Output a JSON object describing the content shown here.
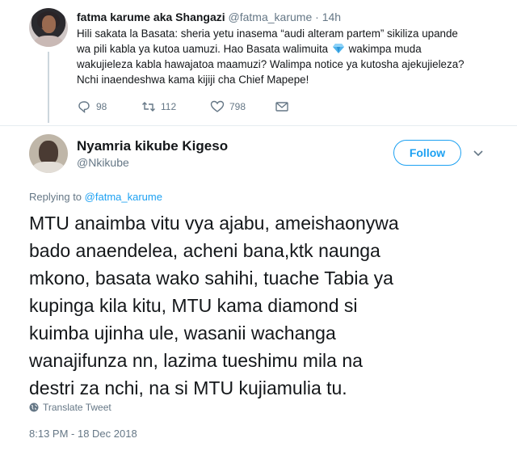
{
  "parent_tweet": {
    "name": "fatma karume aka Shangazi",
    "handle": "@fatma_karume",
    "separator": "·",
    "time": "14h",
    "lines": [
      "Hili sakata la Basata: sheria yetu inasema “audi alteram partem” sikiliza upande",
      "wa pili kabla ya kutoa uamuzi. Hao Basata walimuita",
      "wakimpa muda",
      "wakujieleza kabla hawajatoa maamuzi? Walimpa notice ya kutosha ajekujieleza?",
      "Nchi inaendeshwa kama kijiji cha Chief Mapepe!"
    ],
    "emoji": "gem-stone-icon",
    "actions": {
      "replies": "98",
      "retweets": "112",
      "likes": "798"
    }
  },
  "tweet": {
    "name": "Nyamria kikube Kigeso",
    "handle": "@Nkikube",
    "follow_label": "Follow",
    "replying_prefix": "Replying to",
    "replying_to": "@fatma_karume",
    "lines": [
      "MTU anaimba vitu vya ajabu, ameishaonywa",
      "bado anaendelea, acheni bana,ktk naunga",
      "mkono, basata wako sahihi, tuache Tabia ya",
      "kupinga kila kitu, MTU kama diamond si",
      "kuimba ujinha ule, wasanii wachanga",
      "wanajifunza nn, lazima tueshimu mila na",
      "destri za nchi, na si MTU kujiamulia tu."
    ],
    "translate_label": "Translate Tweet",
    "timestamp": "8:13 PM - 18 Dec 2018"
  },
  "colors": {
    "accent": "#1da1f2",
    "secondary_text": "#657786",
    "divider": "#e6ecf0"
  }
}
